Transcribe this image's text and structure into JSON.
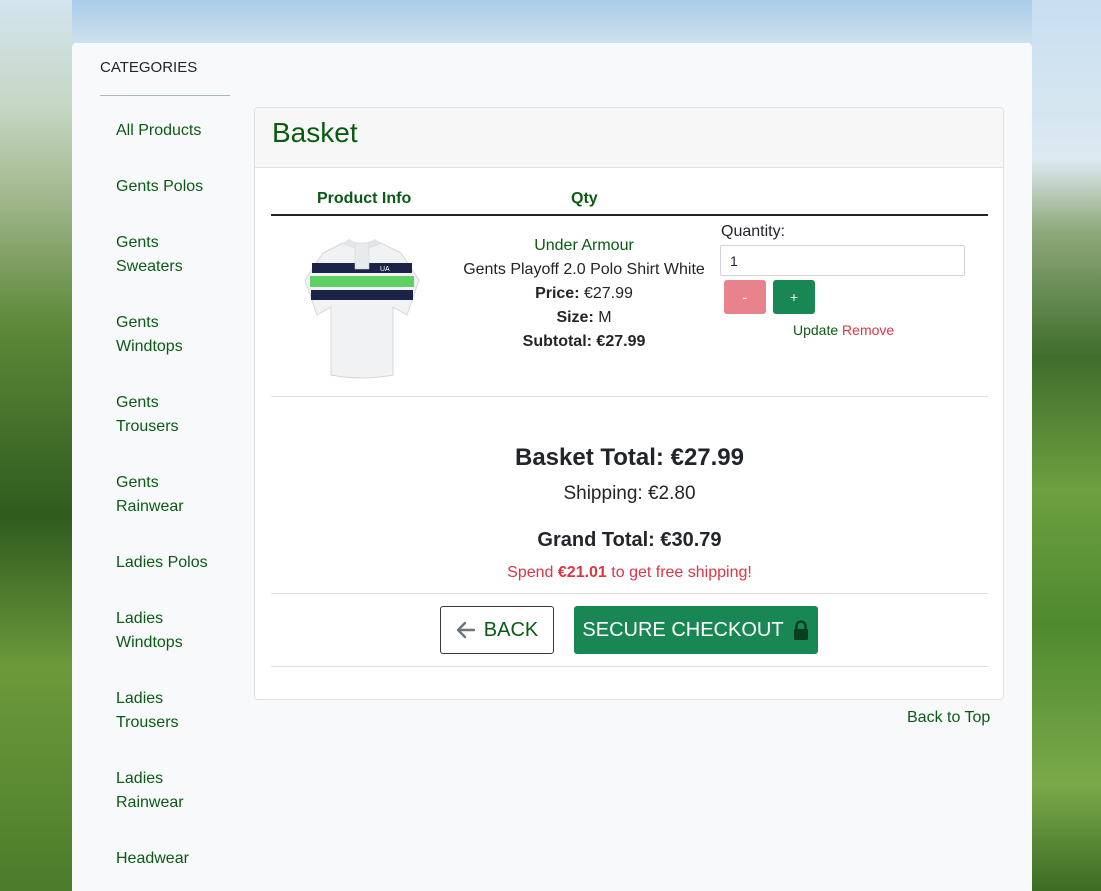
{
  "sidebar": {
    "title": "CATEGORIES",
    "items": [
      {
        "label": "All Products"
      },
      {
        "label": "Gents Polos"
      },
      {
        "label": "Gents Sweaters"
      },
      {
        "label": "Gents Windtops"
      },
      {
        "label": "Gents Trousers"
      },
      {
        "label": "Gents Rainwear"
      },
      {
        "label": "Ladies Polos"
      },
      {
        "label": "Ladies Windtops"
      },
      {
        "label": "Ladies Trousers"
      },
      {
        "label": "Ladies Rainwear"
      },
      {
        "label": "Headwear"
      }
    ]
  },
  "basket": {
    "title": "Basket",
    "columns": {
      "product_info": "Product Info",
      "qty": "Qty"
    },
    "item": {
      "brand": "Under Armour",
      "name": "Gents Playoff 2.0 Polo Shirt White",
      "price_label": "Price:",
      "price": "€27.99",
      "size_label": "Size:",
      "size": "M",
      "subtotal_label": "Subtotal:",
      "subtotal": "€27.99",
      "quantity_label": "Quantity:",
      "quantity": "1",
      "minus": "-",
      "plus": "+",
      "update": "Update",
      "remove": "Remove"
    },
    "totals": {
      "basket_total": "Basket Total: €27.99",
      "shipping": "Shipping: €2.80",
      "grand_total": "Grand Total: €30.79",
      "free_ship_prefix": "Spend ",
      "free_ship_amount": "€21.01",
      "free_ship_suffix": " to get free shipping!"
    },
    "back_label": "BACK",
    "checkout_label": "SECURE CHECKOUT"
  },
  "footer": {
    "back_to_top": "Back to Top"
  },
  "icons": {
    "back": "arrow-left-icon",
    "checkout": "lock-icon"
  },
  "colors": {
    "brand_green": "#0b5a13",
    "button_green": "#198754",
    "danger": "#dc3545"
  }
}
